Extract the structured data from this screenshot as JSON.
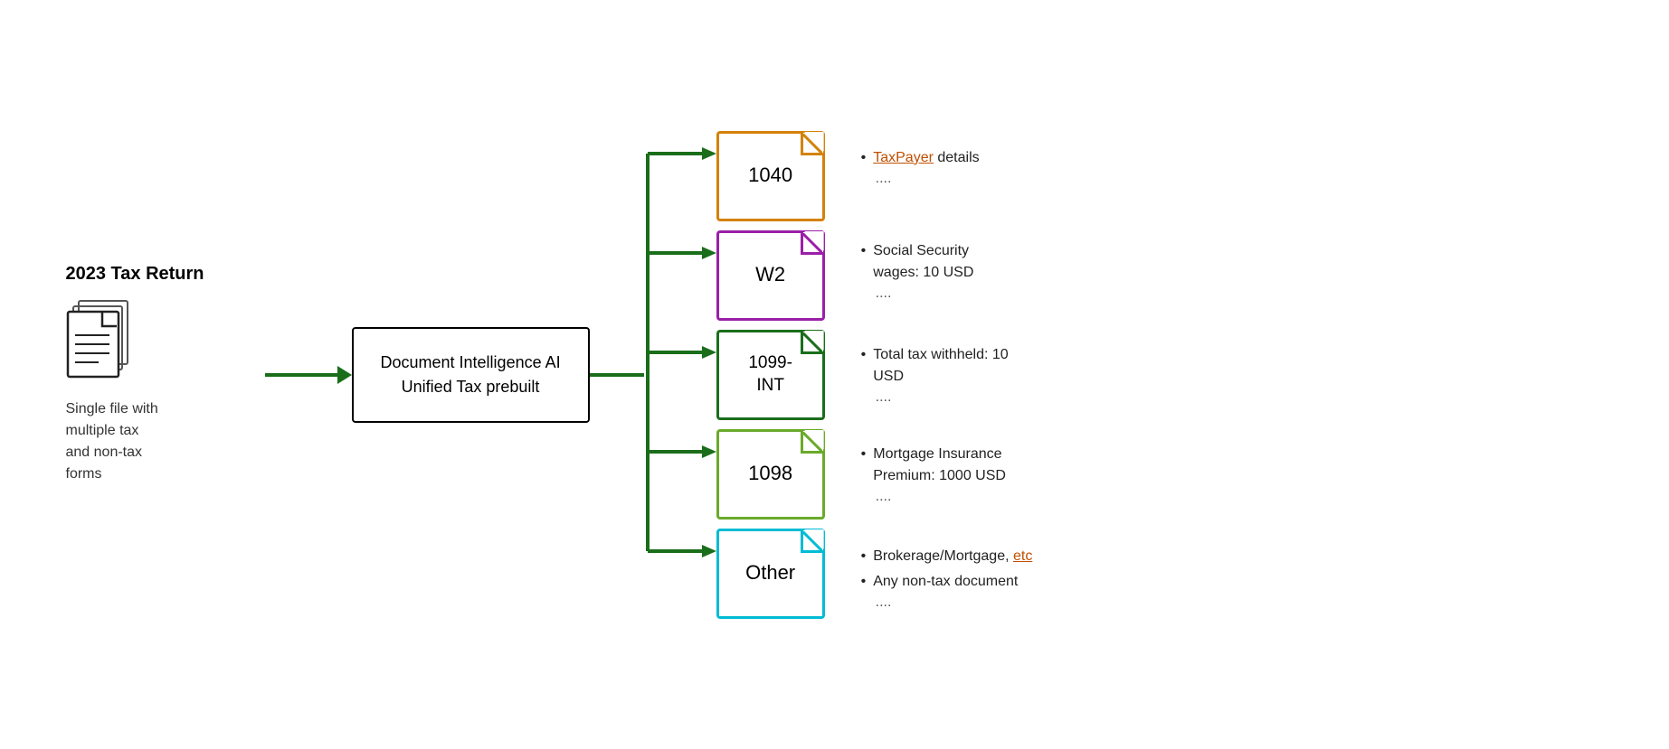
{
  "diagram": {
    "doc_title": "2023 Tax Return",
    "doc_label_line1": "Single file with",
    "doc_label_line2": "multiple tax",
    "doc_label_line3": "and non-tax",
    "doc_label_line4": "forms",
    "center_box_line1": "Document Intelligence AI",
    "center_box_line2": "Unified Tax prebuilt",
    "forms": [
      {
        "id": "1040",
        "label": "1040",
        "color": "#d4820a",
        "class": "card-1040"
      },
      {
        "id": "W2",
        "label": "W2",
        "color": "#9b1fa8",
        "class": "card-w2"
      },
      {
        "id": "1099",
        "label": "1099-\nINT",
        "color": "#1a6e1a",
        "class": "card-1099"
      },
      {
        "id": "1098",
        "label": "1098",
        "color": "#6aaa2a",
        "class": "card-1098"
      },
      {
        "id": "Other",
        "label": "Other",
        "color": "#00bcd4",
        "class": "card-other"
      }
    ],
    "info_groups": [
      {
        "items": [
          {
            "text_prefix": "",
            "link_text": "TaxPayer",
            "text_suffix": " details"
          }
        ],
        "dots": "...."
      },
      {
        "items": [
          {
            "text": "Social Security wages: 10 USD"
          }
        ],
        "dots": "...."
      },
      {
        "items": [
          {
            "text": "Total tax withheld: 10 USD"
          }
        ],
        "dots": "...."
      },
      {
        "items": [
          {
            "text": "Mortgage Insurance Premium: 1000 USD"
          }
        ],
        "dots": "...."
      },
      {
        "items": [
          {
            "text_prefix": " Brokerage/Mortgage, ",
            "link_text": "etc",
            "text_suffix": ""
          },
          {
            "text": " Any non-tax document"
          }
        ],
        "dots": "...."
      }
    ]
  }
}
